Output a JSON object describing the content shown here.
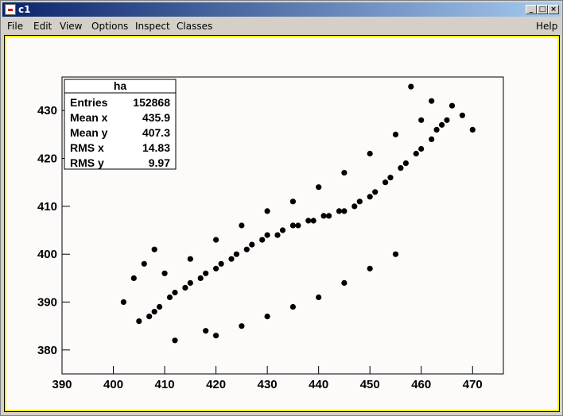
{
  "window": {
    "title": "c1",
    "minimize": "_",
    "maximize": "□",
    "close": "×"
  },
  "menu": {
    "file": "File",
    "edit": "Edit",
    "view": "View",
    "options": "Options",
    "inspect": "Inspect",
    "classes": "Classes",
    "help": "Help"
  },
  "stats": {
    "title": "ha",
    "rows": [
      {
        "label": "Entries",
        "value": "152868"
      },
      {
        "label": "Mean x",
        "value": "435.9"
      },
      {
        "label": "Mean y",
        "value": "407.3"
      },
      {
        "label": "RMS x",
        "value": "14.83"
      },
      {
        "label": "RMS y",
        "value": "9.97"
      }
    ]
  },
  "chart_data": {
    "type": "scatter",
    "title": "",
    "xlabel": "",
    "ylabel": "",
    "xlim": [
      390,
      476
    ],
    "ylim": [
      375,
      437
    ],
    "x_ticks": [
      "390",
      "400",
      "410",
      "420",
      "430",
      "440",
      "450",
      "460",
      "470"
    ],
    "y_ticks": [
      "380",
      "390",
      "400",
      "410",
      "420",
      "430"
    ],
    "entries": 152868,
    "mean_x": 435.9,
    "mean_y": 407.3,
    "rms_x": 14.83,
    "rms_y": 9.97,
    "density_colors": [
      "#000000"
    ],
    "points": [
      [
        405,
        386
      ],
      [
        407,
        387
      ],
      [
        409,
        389
      ],
      [
        412,
        392
      ],
      [
        415,
        394
      ],
      [
        418,
        396
      ],
      [
        421,
        398
      ],
      [
        424,
        400
      ],
      [
        427,
        402
      ],
      [
        430,
        404
      ],
      [
        433,
        405
      ],
      [
        436,
        406
      ],
      [
        439,
        407
      ],
      [
        442,
        408
      ],
      [
        445,
        409
      ],
      [
        448,
        411
      ],
      [
        451,
        413
      ],
      [
        454,
        416
      ],
      [
        457,
        419
      ],
      [
        460,
        422
      ],
      [
        463,
        426
      ],
      [
        465,
        428
      ],
      [
        408,
        388
      ],
      [
        411,
        391
      ],
      [
        414,
        393
      ],
      [
        417,
        395
      ],
      [
        420,
        397
      ],
      [
        423,
        399
      ],
      [
        426,
        401
      ],
      [
        429,
        403
      ],
      [
        432,
        404
      ],
      [
        435,
        406
      ],
      [
        438,
        407
      ],
      [
        441,
        408
      ],
      [
        444,
        409
      ],
      [
        447,
        410
      ],
      [
        450,
        412
      ],
      [
        453,
        415
      ],
      [
        456,
        418
      ],
      [
        459,
        421
      ],
      [
        462,
        424
      ],
      [
        464,
        427
      ],
      [
        410,
        396
      ],
      [
        415,
        399
      ],
      [
        420,
        403
      ],
      [
        425,
        406
      ],
      [
        430,
        409
      ],
      [
        435,
        411
      ],
      [
        440,
        414
      ],
      [
        445,
        417
      ],
      [
        450,
        421
      ],
      [
        455,
        425
      ],
      [
        460,
        428
      ],
      [
        420,
        383
      ],
      [
        425,
        385
      ],
      [
        430,
        387
      ],
      [
        435,
        389
      ],
      [
        440,
        391
      ],
      [
        445,
        394
      ],
      [
        450,
        397
      ],
      [
        455,
        400
      ],
      [
        412,
        382
      ],
      [
        418,
        384
      ],
      [
        402,
        390
      ],
      [
        404,
        395
      ],
      [
        406,
        398
      ],
      [
        408,
        401
      ],
      [
        466,
        431
      ],
      [
        468,
        429
      ],
      [
        470,
        426
      ],
      [
        462,
        432
      ],
      [
        458,
        435
      ]
    ]
  }
}
